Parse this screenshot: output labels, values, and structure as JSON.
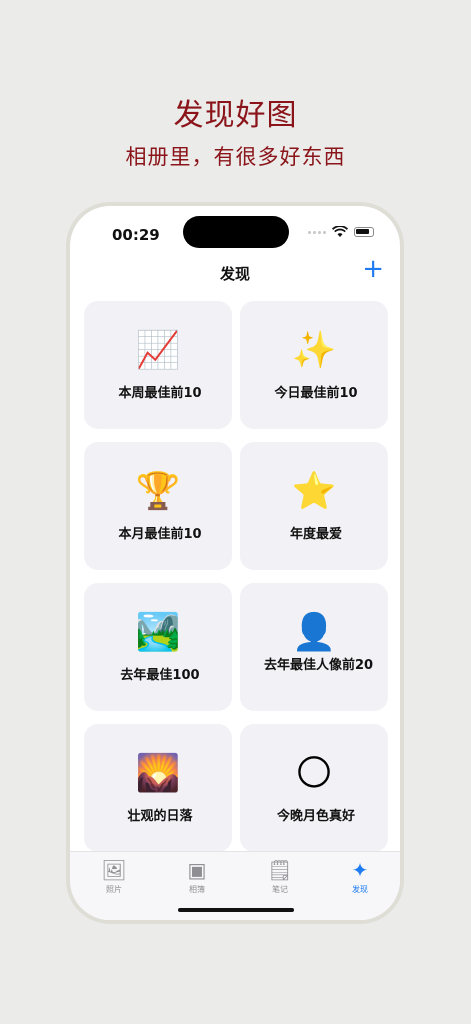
{
  "promo": {
    "title": "发现好图",
    "subtitle": "相册里，有很多好东西"
  },
  "status_bar": {
    "time": "00:29"
  },
  "nav": {
    "title": "发现",
    "add_icon": "plus-icon",
    "accent_color": "#1e7bf2"
  },
  "cards": [
    {
      "emoji": "📈",
      "label": "本周最佳前10"
    },
    {
      "emoji": "✨",
      "label": "今日最佳前10"
    },
    {
      "emoji": "🏆",
      "label": "本月最佳前10"
    },
    {
      "emoji": "⭐",
      "label": "年度最爱"
    },
    {
      "emoji": "🏞️",
      "label": "去年最佳100"
    },
    {
      "emoji": "👤",
      "label": "去年最佳人像前20"
    },
    {
      "emoji": "🌄",
      "label": "壮观的日落"
    },
    {
      "emoji": "🌕",
      "label": "今晚月色真好"
    }
  ],
  "tabs": [
    {
      "icon": "photo-icon",
      "glyph": "🖼",
      "label": "照片"
    },
    {
      "icon": "albums-icon",
      "glyph": "▣",
      "label": "相簿"
    },
    {
      "icon": "notes-icon",
      "glyph": "🗒",
      "label": "笔记"
    },
    {
      "icon": "sparkles-icon",
      "glyph": "✦",
      "label": "发现"
    }
  ]
}
